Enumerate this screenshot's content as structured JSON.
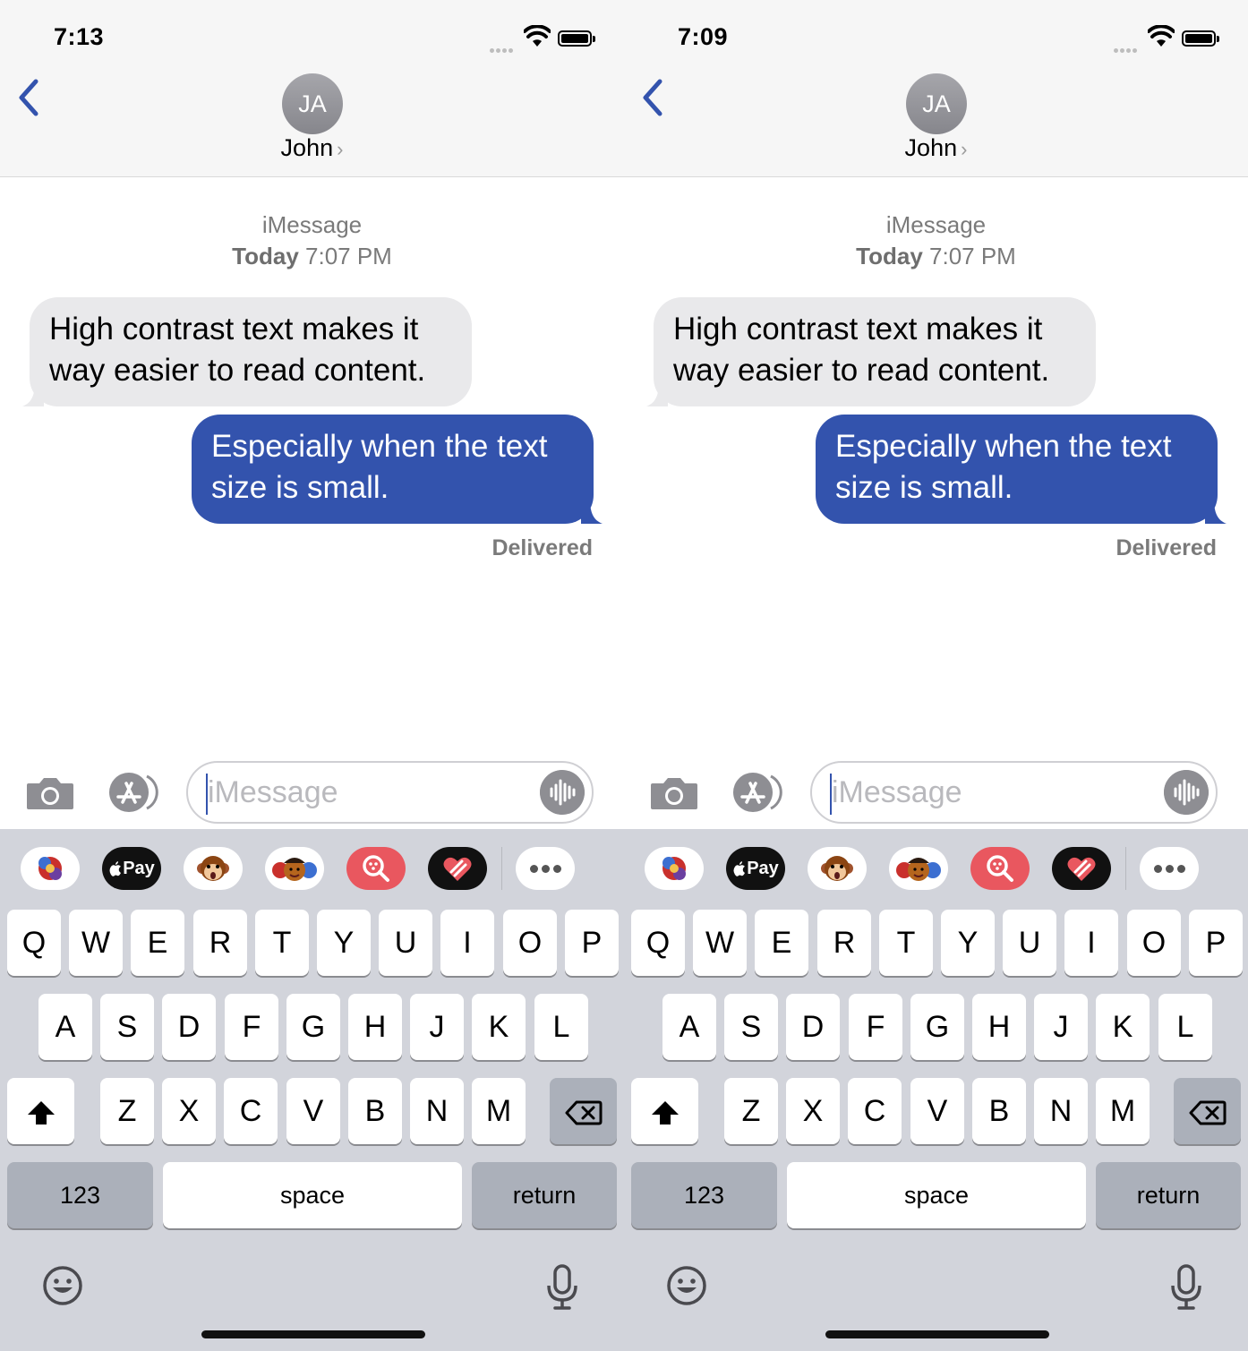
{
  "screens": [
    {
      "status_time": "7:13",
      "contact": {
        "initials": "JA",
        "name": "John",
        "chevron": "›"
      },
      "conversation": {
        "service": "iMessage",
        "day": "Today",
        "time": "7:07 PM",
        "received": "High contrast text makes it way easier to read content.",
        "sent": "Especially when the text size is small.",
        "status": "Delivered"
      },
      "input": {
        "placeholder": "iMessage"
      }
    },
    {
      "status_time": "7:09",
      "contact": {
        "initials": "JA",
        "name": "John",
        "chevron": "›"
      },
      "conversation": {
        "service": "iMessage",
        "day": "Today",
        "time": "7:07 PM",
        "received": "High contrast text makes it way easier to read content.",
        "sent": "Especially when the text size is small.",
        "status": "Delivered"
      },
      "input": {
        "placeholder": "iMessage"
      }
    }
  ],
  "app_strip": {
    "apple_pay_label": "Pay",
    "icons": [
      "memoji-stickers-icon",
      "apple-pay-icon",
      "animoji-monkey-icon",
      "memoji-faces-icon",
      "images-search-icon",
      "digital-touch-icon",
      "more-apps-icon"
    ]
  },
  "keyboard": {
    "row1": [
      "Q",
      "W",
      "E",
      "R",
      "T",
      "Y",
      "U",
      "I",
      "O",
      "P"
    ],
    "row2": [
      "A",
      "S",
      "D",
      "F",
      "G",
      "H",
      "J",
      "K",
      "L"
    ],
    "row3": [
      "Z",
      "X",
      "C",
      "V",
      "B",
      "N",
      "M"
    ],
    "numbers_label": "123",
    "space_label": "space",
    "return_label": "return"
  },
  "colors": {
    "sent_bubble": "#3353ad",
    "received_bubble": "#e9e9eb",
    "accent": "#3353ad",
    "keyboard_bg": "#d2d4db",
    "dark_key": "#abb0ba"
  }
}
